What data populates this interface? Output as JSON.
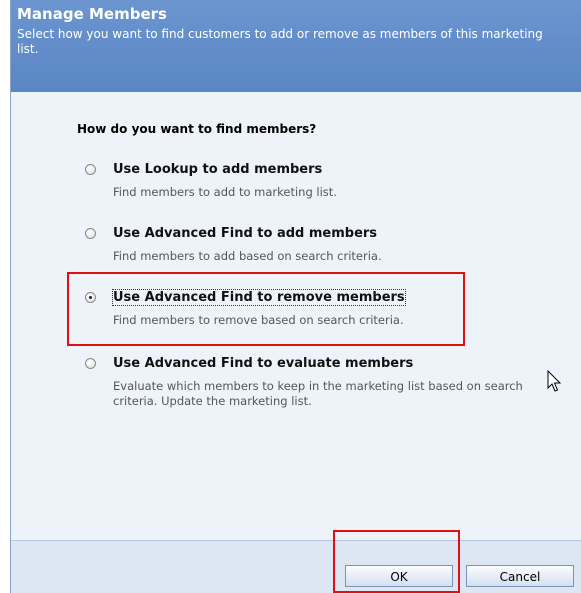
{
  "header": {
    "title": "Manage Members",
    "description": "Select how you want to find customers to add or remove as members of this marketing list."
  },
  "body": {
    "question": "How do you want to find members?",
    "options": [
      {
        "label": "Use Lookup to add members",
        "description": "Find members to add to marketing list.",
        "checked": false
      },
      {
        "label": "Use Advanced Find to add members",
        "description": "Find members to add based on search criteria.",
        "checked": false
      },
      {
        "label": "Use Advanced Find to remove members",
        "description": "Find members to remove based on search criteria.",
        "checked": true
      },
      {
        "label": "Use Advanced Find to evaluate members",
        "description": "Evaluate which members to keep in the marketing list based on search criteria. Update the marketing list.",
        "checked": false
      }
    ]
  },
  "footer": {
    "ok_label": "OK",
    "cancel_label": "Cancel"
  },
  "colors": {
    "header_bg": "#5f8bca",
    "highlight": "#e01010"
  }
}
